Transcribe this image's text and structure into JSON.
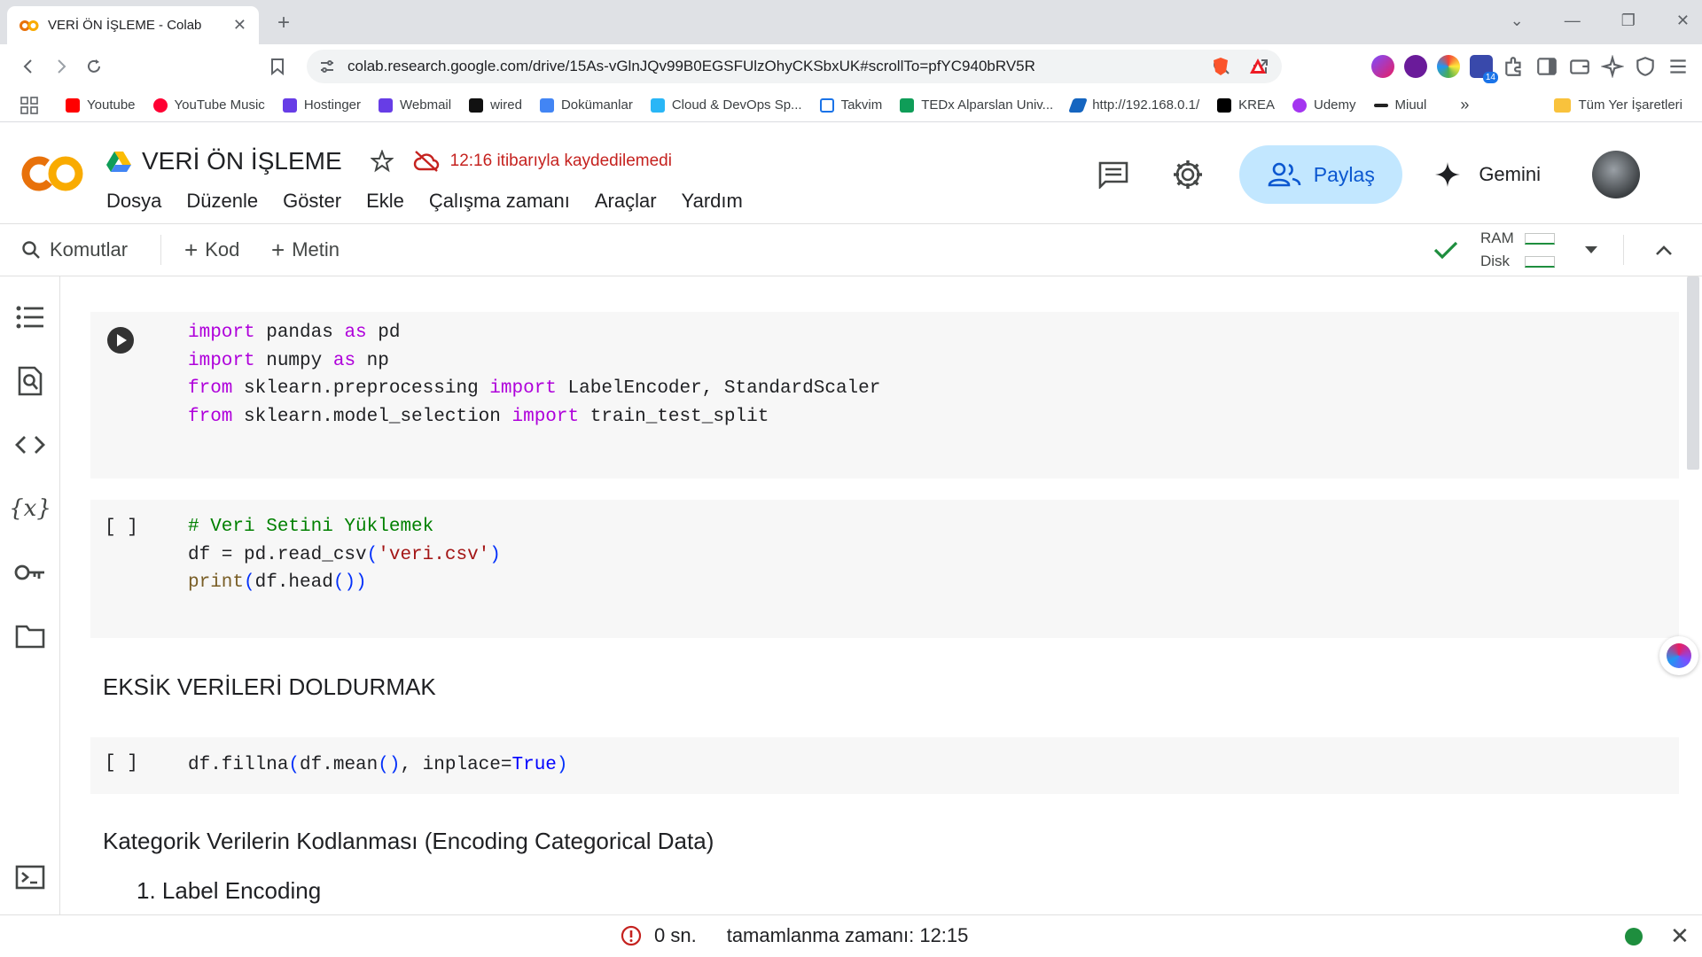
{
  "browser": {
    "tab_title": "VERİ ÖN İŞLEME - Colab",
    "url": "colab.research.google.com/drive/15As-vGlnJQv99B0EGSFUlzOhyCKSbxUK#scrollTo=pfYC940bRV5R",
    "extension_badge": "14",
    "bookmarks": [
      {
        "label": "Youtube",
        "color": "#ff0000"
      },
      {
        "label": "YouTube Music",
        "color": "#ff0033"
      },
      {
        "label": "Hostinger",
        "color": "#673de6"
      },
      {
        "label": "Webmail",
        "color": "#673de6"
      },
      {
        "label": "wired",
        "color": "#111111"
      },
      {
        "label": "Dokümanlar",
        "color": "#4285f4"
      },
      {
        "label": "Cloud & DevOps Sp...",
        "color": "#29b6f6"
      },
      {
        "label": "Takvim",
        "color": "#1a73e8"
      },
      {
        "label": "TEDx Alparslan Univ...",
        "color": "#0f9d58"
      },
      {
        "label": "http://192.168.0.1/",
        "color": "#1565c0"
      },
      {
        "label": "KREA",
        "color": "#000000"
      },
      {
        "label": "Udemy",
        "color": "#a435f0"
      },
      {
        "label": "Miuul",
        "color": "#222222"
      }
    ],
    "bookmarks_more": "»",
    "all_bookmarks": "Tüm Yer İşaretleri"
  },
  "colab": {
    "title": "VERİ ÖN İŞLEME",
    "save_warning": "12:16 itibarıyla kaydedilemedi",
    "menu": [
      "Dosya",
      "Düzenle",
      "Göster",
      "Ekle",
      "Çalışma zamanı",
      "Araçlar",
      "Yardım"
    ],
    "share_label": "Paylaş",
    "gemini_label": "Gemini"
  },
  "toolbar": {
    "commands_label": "Komutlar",
    "add_code_label": "Kod",
    "add_text_label": "Metin",
    "ram_label": "RAM",
    "disk_label": "Disk"
  },
  "cells": {
    "cell1_lines": [
      "import pandas as pd",
      "import numpy as np",
      "from sklearn.preprocessing import LabelEncoder, StandardScaler",
      "from sklearn.model_selection import train_test_split"
    ],
    "cell2_lines": [
      "# Veri Setini Yüklemek",
      "df = pd.read_csv('veri.csv')",
      "print(df.head())"
    ],
    "text1": "EKSİK VERİLERİ DOLDURMAK",
    "cell3_line": "df.fillna(df.mean(), inplace=True)",
    "text2": "Kategorik Verilerin Kodlanması (Encoding Categorical Data)",
    "text3": "1. Label Encoding",
    "empty_bracket": "[ ]"
  },
  "status": {
    "elapsed": "0 sn.",
    "completed": "tamamlanma zamanı: 12:15"
  },
  "colors": {
    "accent": "#0b57d0",
    "share_bg": "#c2e7ff",
    "warning": "#c5221f",
    "connected": "#1e8e3e"
  }
}
